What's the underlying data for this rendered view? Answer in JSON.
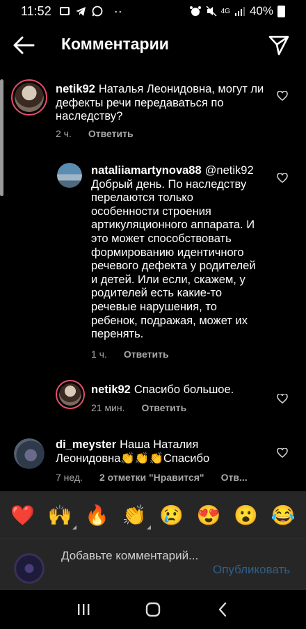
{
  "statusbar": {
    "time": "11:52",
    "left_icons": [
      "gallery-icon",
      "telegram-icon",
      "whatsapp-icon",
      "dots-icon"
    ],
    "dots": "··",
    "network": "4G",
    "battery": "40%"
  },
  "header": {
    "title": "Комментарии"
  },
  "comments": [
    {
      "user": "netik92",
      "text": "Наталья Леонидовна, могут ли дефекты речи передаваться по наследству?",
      "time": "2 ч.",
      "reply": "Ответить",
      "likes": ""
    },
    {
      "user": "nataliiamartynova88",
      "text": "@netik92 Добрый день. По наследству перелаются только особенности строения артикуляционного аппарата. И это может способствовать формированию идентичного речевого дефекта у родителей и детей. Или если, скажем, у родителей есть какие-то речевые нарушения, то ребенок, подражая, может их перенять.",
      "time": "1 ч.",
      "reply": "Ответить",
      "likes": ""
    },
    {
      "user": "netik92",
      "text": "Спасибо большое.",
      "time": "21 мин.",
      "reply": "Ответить",
      "likes": ""
    },
    {
      "user": "di_meyster",
      "text": "Наша Наталия Леонидовна👏👏👏Спасибо",
      "time": "7 нед.",
      "reply": "Отв...",
      "likes": "2 отметки \"Нравится\""
    }
  ],
  "emojis": [
    "❤️",
    "🙌",
    "🔥",
    "👏",
    "😢",
    "😍",
    "😮",
    "😂"
  ],
  "input": {
    "placeholder": "Добавьте комментарий...",
    "publish": "Опубликовать"
  },
  "colors": {
    "background": "#000000",
    "ring": "#e64e6f",
    "meta": "#a8a8a8",
    "panel": "#262626",
    "publish": "#2f5f8a"
  }
}
